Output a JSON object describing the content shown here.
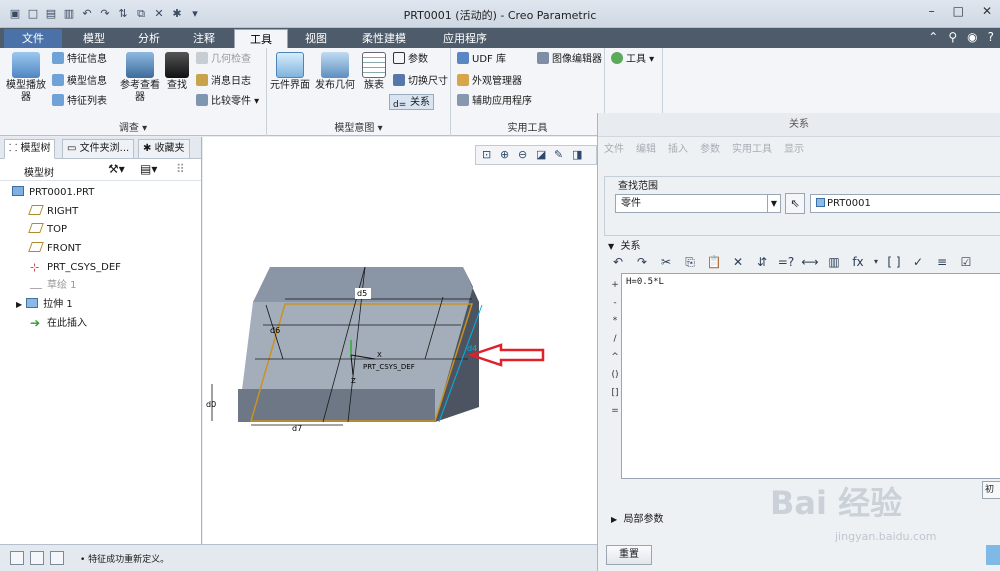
{
  "window": {
    "title": "PRT0001 (活动的) - Creo Parametric"
  },
  "tabs": [
    {
      "label": "文件"
    },
    {
      "label": "模型"
    },
    {
      "label": "分析"
    },
    {
      "label": "注释"
    },
    {
      "label": "工具"
    },
    {
      "label": "视图"
    },
    {
      "label": "柔性建模"
    },
    {
      "label": "应用程序"
    }
  ],
  "active_tab": "工具",
  "ribbon": {
    "investigate": {
      "label": "调查",
      "model_player": "模型播放器",
      "feature_info": "特征信息",
      "model_info": "模型信息",
      "feature_list": "特征列表",
      "reference_viewer": "参考查看器",
      "find": "查找",
      "geometry_check": "几何检查",
      "message_log": "消息日志",
      "compare_parts": "比较零件"
    },
    "model_intent": {
      "label": "模型意图",
      "component_interface": "元件界面",
      "publish_geometry": "发布几何",
      "family_table": "族表",
      "parameters": "参数",
      "switch_dimensions": "切换尺寸",
      "relations": "关系"
    },
    "utilities": {
      "label": "实用工具",
      "udf_library": "UDF 库",
      "appearance_manager": "外观管理器",
      "auxiliary_apps": "辅助应用程序",
      "image_editor": "图像编辑器",
      "tools": "工具"
    }
  },
  "left_panel": {
    "tabs": [
      "模型树",
      "文件夹浏...",
      "收藏夹"
    ],
    "header": "模型树",
    "tree": [
      {
        "label": "PRT0001.PRT",
        "type": "part"
      },
      {
        "label": "RIGHT",
        "type": "datum-plane"
      },
      {
        "label": "TOP",
        "type": "datum-plane"
      },
      {
        "label": "FRONT",
        "type": "datum-plane"
      },
      {
        "label": "PRT_CSYS_DEF",
        "type": "csys"
      },
      {
        "label": "草绘 1",
        "type": "sketch",
        "dimmed": true
      },
      {
        "label": "拉伸 1",
        "type": "extrude"
      },
      {
        "label": "在此插入",
        "type": "insert-here"
      }
    ]
  },
  "graphics": {
    "dims": [
      "d5",
      "d6",
      "d4",
      "d0",
      "d7"
    ],
    "csys_label": "PRT_CSYS_DEF",
    "axis_x": "X",
    "axis_z": "Z"
  },
  "dialog": {
    "title": "关系",
    "menu": [
      "文件",
      "编辑",
      "插入",
      "参数",
      "实用工具",
      "显示"
    ],
    "lookup_label": "查找范围",
    "lookup_type": "零件",
    "lookup_object": "PRT0001",
    "relations_label": "关系",
    "relation_text": "H=0.5*L",
    "operators": [
      "+",
      "-",
      "*",
      "/",
      "^",
      "()",
      "[]",
      "="
    ],
    "local_params": "局部参数",
    "reset": "重置",
    "partial_button": "初"
  },
  "status": {
    "message": "特征成功重新定义。"
  },
  "watermark": {
    "text": "Bai 经验",
    "sub": "jingyan.baidu.com"
  },
  "colors": {
    "accent": "#4a72a8",
    "tab_bar": "#4d5b6b",
    "arrow": "#e0202a",
    "dim_line": "#00b4e6"
  }
}
